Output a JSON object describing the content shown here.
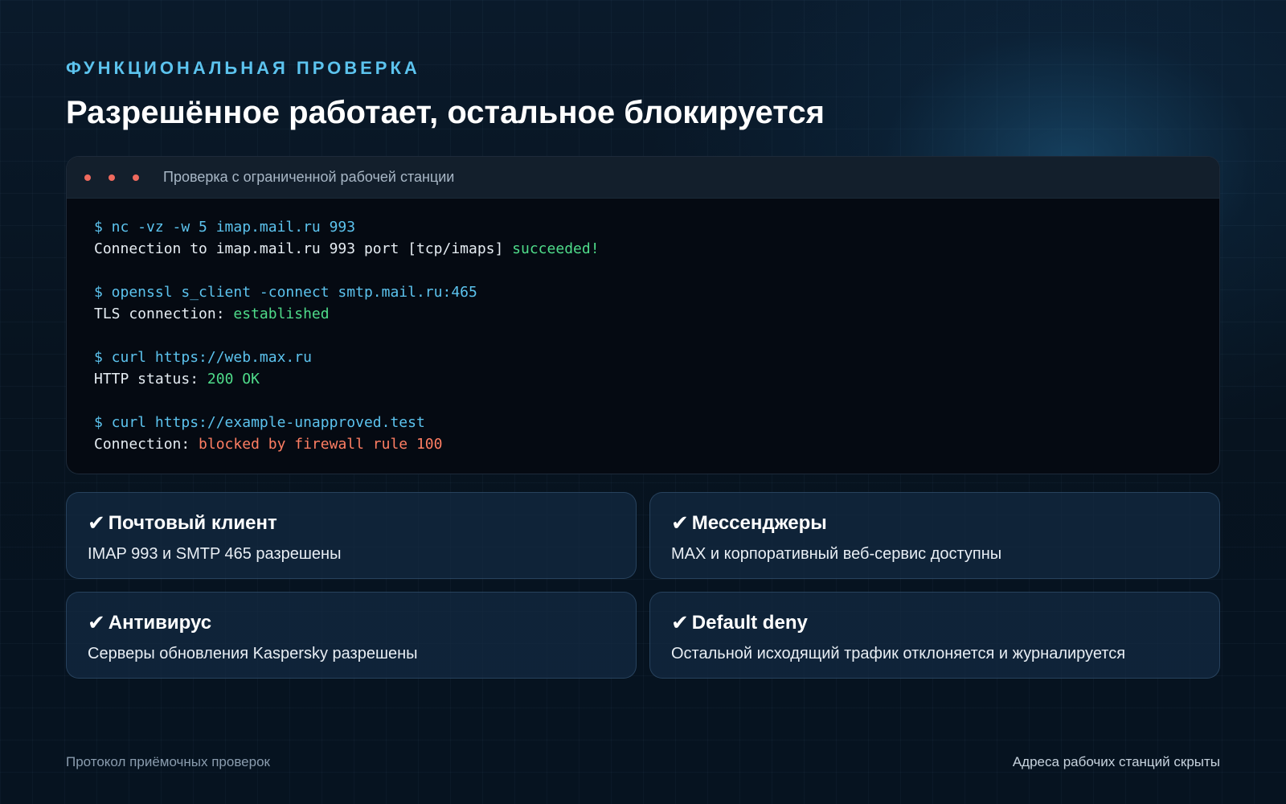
{
  "header": {
    "kicker": "ФУНКЦИОНАЛЬНАЯ ПРОВЕРКА",
    "title": "Разрешённое работает, остальное блокируется"
  },
  "terminal": {
    "title": "Проверка с ограниченной рабочей станции",
    "blocks": [
      {
        "command": "$ nc -vz -w 5 imap.mail.ru 993",
        "output_prefix": "Connection to imap.mail.ru 993 port [tcp/imaps] ",
        "output_status": "succeeded!"
      },
      {
        "command": "$ openssl s_client -connect smtp.mail.ru:465",
        "output_prefix": "TLS connection: ",
        "output_status": "established"
      },
      {
        "command": "$ curl https://web.max.ru",
        "output_prefix": "HTTP status: ",
        "output_status": "200 OK"
      },
      {
        "command": "$ curl https://example-unapproved.test",
        "output_prefix": "Connection: ",
        "output_status": "blocked by firewall rule 100"
      }
    ]
  },
  "cards": [
    {
      "check": "✔",
      "title": "Почтовый клиент",
      "text": "IMAP 993 и SMTP 465 разрешены"
    },
    {
      "check": "✔",
      "title": "Мессенджеры",
      "text": "MAX и корпоративный веб-сервис доступны"
    },
    {
      "check": "✔",
      "title": "Антивирус",
      "text": "Серверы обновления Kaspersky разрешены"
    },
    {
      "check": "✔",
      "title": "Default deny",
      "text": "Остальной исходящий трафик отклоняется и журналируется"
    }
  ],
  "footer": {
    "left": "Протокол приёмочных проверок",
    "right": "Адреса рабочих станций скрыты"
  },
  "colors": {
    "accent": "#5cc3ee",
    "success": "#4fdc8a",
    "error": "#ff7e63",
    "window_dot": "#ef6a5e"
  }
}
